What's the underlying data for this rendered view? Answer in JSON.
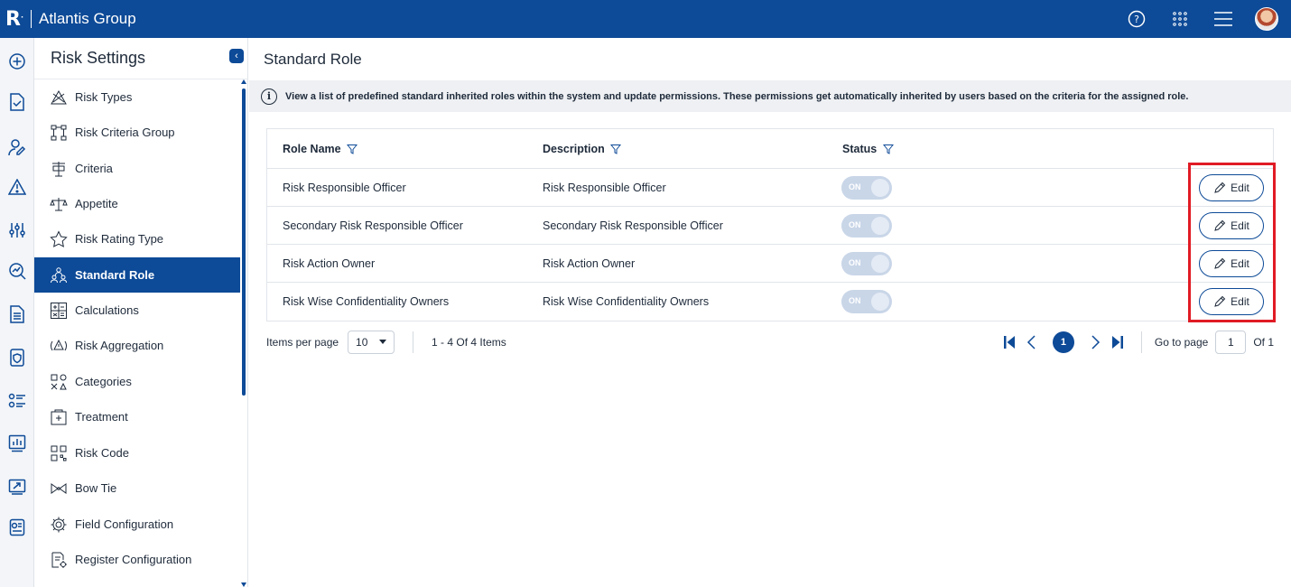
{
  "topbar": {
    "logo": "R",
    "app_title": "Atlantis Group",
    "icons": [
      "help-icon",
      "apps-grid-icon",
      "menu-icon",
      "avatar"
    ]
  },
  "rail": {
    "icons": [
      "add-circle-icon",
      "document-check-icon",
      "user-edit-icon",
      "warning-icon",
      "slider-settings-icon",
      "search-analytics-icon",
      "document-icon",
      "shield-document-icon",
      "checklist-icon",
      "bar-chart-icon",
      "trend-chart-icon",
      "report-icon"
    ]
  },
  "sidebar": {
    "title": "Risk Settings",
    "items": [
      {
        "label": "Risk Types",
        "icon": "risk-types-icon"
      },
      {
        "label": "Risk Criteria Group",
        "icon": "criteria-group-icon"
      },
      {
        "label": "Criteria",
        "icon": "criteria-icon"
      },
      {
        "label": "Appetite",
        "icon": "appetite-icon"
      },
      {
        "label": "Risk Rating Type",
        "icon": "star-icon"
      },
      {
        "label": "Standard Role",
        "icon": "roles-icon",
        "active": true
      },
      {
        "label": "Calculations",
        "icon": "calculator-icon"
      },
      {
        "label": "Risk Aggregation",
        "icon": "aggregation-icon"
      },
      {
        "label": "Categories",
        "icon": "categories-icon"
      },
      {
        "label": "Treatment",
        "icon": "treatment-icon"
      },
      {
        "label": "Risk Code",
        "icon": "qr-code-icon"
      },
      {
        "label": "Bow Tie",
        "icon": "bow-tie-icon"
      },
      {
        "label": "Field Configuration",
        "icon": "gear-icon"
      },
      {
        "label": "Register Configuration",
        "icon": "register-config-icon"
      }
    ]
  },
  "main": {
    "title": "Standard Role",
    "info": "View a list of predefined standard inherited roles within the system and update permissions. These permissions get automatically inherited by users based on the criteria for the assigned role.",
    "columns": [
      "Role Name",
      "Description",
      "Status"
    ],
    "rows": [
      {
        "role": "Risk Responsible Officer",
        "description": "Risk Responsible Officer",
        "status": "ON"
      },
      {
        "role": "Secondary Risk Responsible Officer",
        "description": "Secondary Risk Responsible Officer",
        "status": "ON"
      },
      {
        "role": "Risk Action Owner",
        "description": "Risk Action Owner",
        "status": "ON"
      },
      {
        "role": "Risk Wise Confidentiality Owners",
        "description": "Risk Wise Confidentiality Owners",
        "status": "ON"
      }
    ],
    "edit_label": "Edit",
    "highlight_color": "#e01b24"
  },
  "pager": {
    "items_per_page_label": "Items per page",
    "items_per_page_value": "10",
    "summary": "1 - 4 Of 4 Items",
    "current_page": "1",
    "goto_label": "Go to page",
    "goto_value": "1",
    "of_label": "Of 1"
  },
  "colors": {
    "brand": "#0d4a97",
    "toggle_off": "#c9d6e8"
  }
}
